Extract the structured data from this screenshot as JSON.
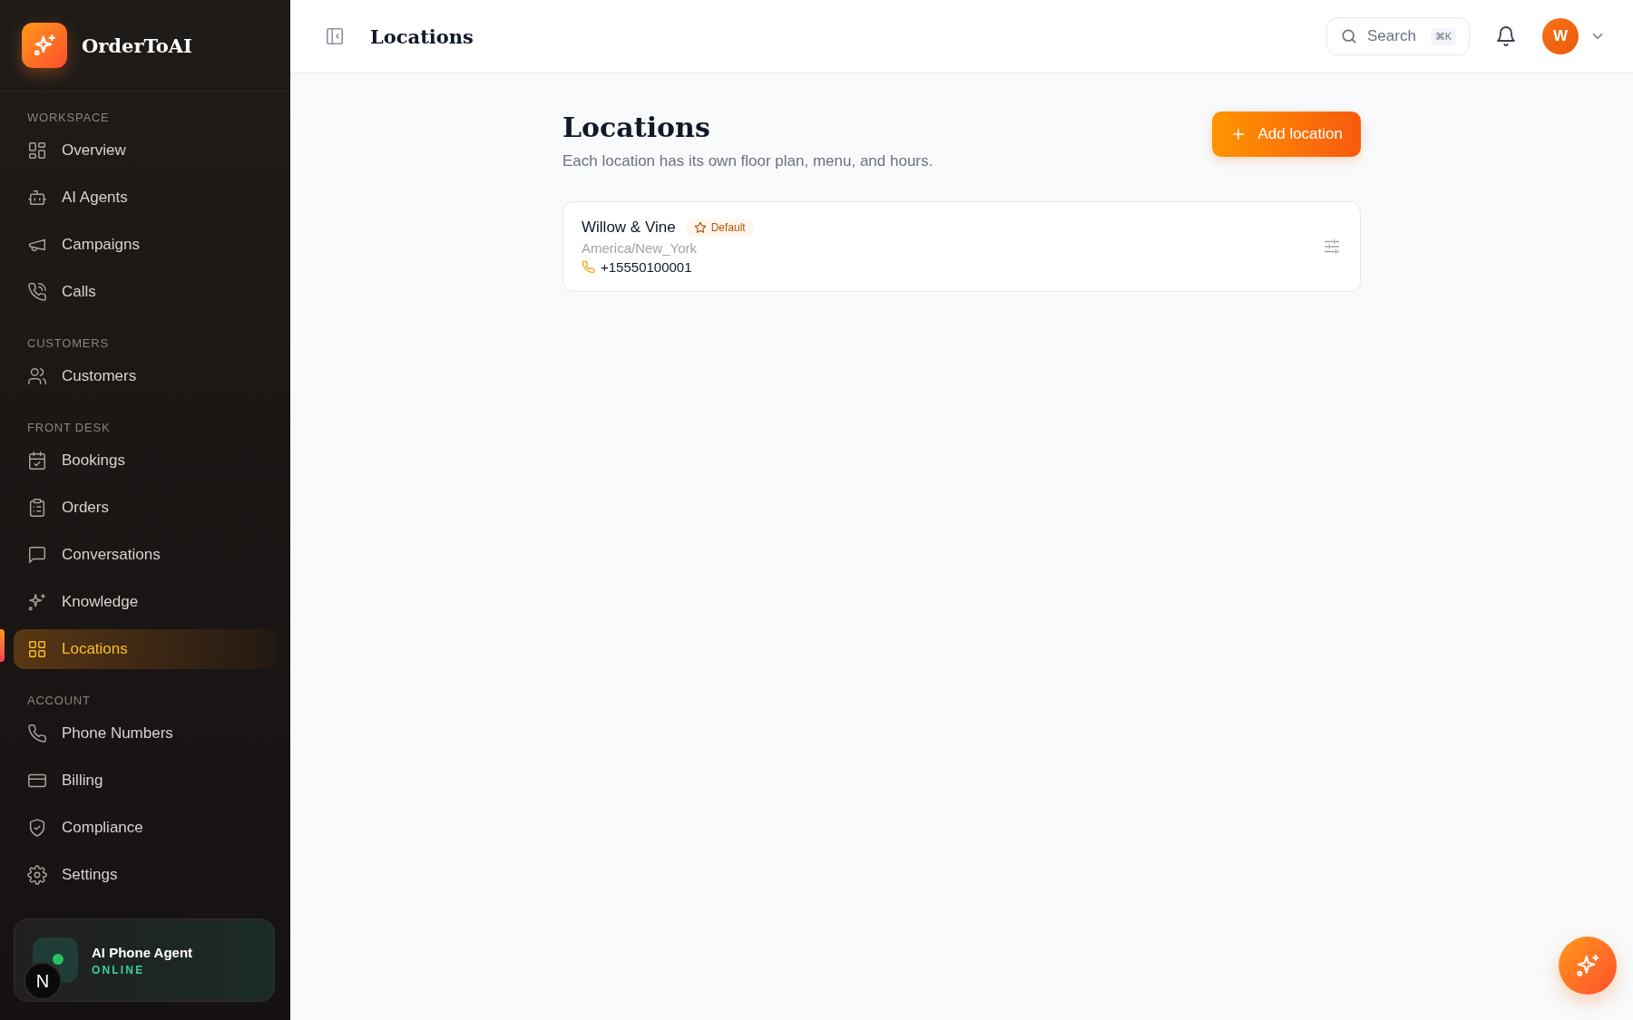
{
  "app": {
    "name": "OrderToAI"
  },
  "sidebar": {
    "sections": [
      {
        "label": "WORKSPACE",
        "items": [
          {
            "label": "Overview",
            "selected": false
          },
          {
            "label": "AI Agents",
            "selected": false
          },
          {
            "label": "Campaigns",
            "selected": false
          },
          {
            "label": "Calls",
            "selected": false
          }
        ]
      },
      {
        "label": "CUSTOMERS",
        "items": [
          {
            "label": "Customers",
            "selected": false
          }
        ]
      },
      {
        "label": "FRONT DESK",
        "items": [
          {
            "label": "Bookings",
            "selected": false
          },
          {
            "label": "Orders",
            "selected": false
          },
          {
            "label": "Conversations",
            "selected": false
          },
          {
            "label": "Knowledge",
            "selected": false
          },
          {
            "label": "Locations",
            "selected": true
          }
        ]
      },
      {
        "label": "ACCOUNT",
        "items": [
          {
            "label": "Phone Numbers",
            "selected": false
          },
          {
            "label": "Billing",
            "selected": false
          },
          {
            "label": "Compliance",
            "selected": false
          },
          {
            "label": "Settings",
            "selected": false
          }
        ]
      }
    ],
    "agent_card": {
      "title": "AI Phone Agent",
      "status": "ONLINE"
    }
  },
  "dev_badge": "N",
  "header": {
    "title": "Locations",
    "search": {
      "placeholder": "Search",
      "shortcut": "⌘K"
    },
    "avatar": "W"
  },
  "page": {
    "title": "Locations",
    "subtitle": "Each location has its own floor plan, menu, and hours.",
    "add_button": "Add location",
    "locations": [
      {
        "name": "Willow & Vine",
        "default": true,
        "default_label": "Default",
        "timezone": "America/New_York",
        "phone": "+15550100001"
      }
    ]
  }
}
